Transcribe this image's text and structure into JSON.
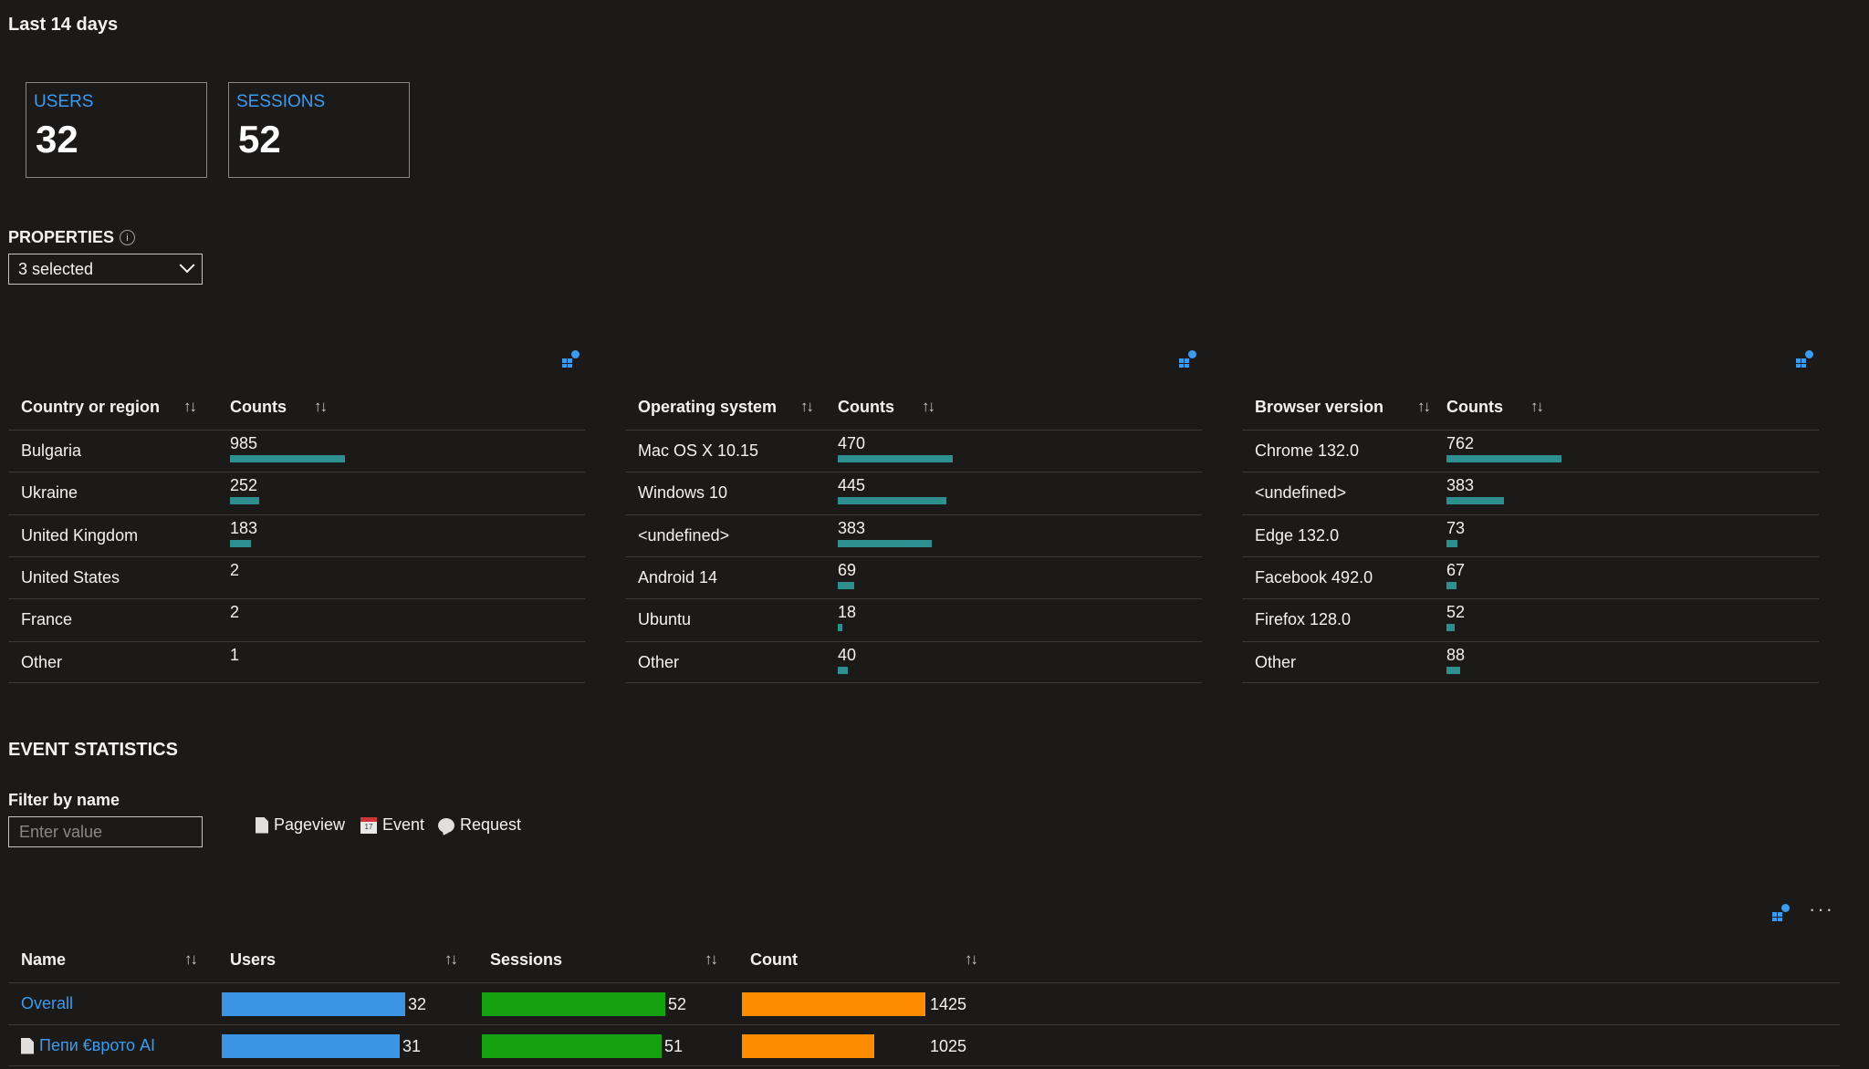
{
  "range_title": "Last 14 days",
  "tiles": [
    {
      "label": "USERS",
      "value": "32"
    },
    {
      "label": "SESSIONS",
      "value": "52"
    }
  ],
  "properties": {
    "label": "PROPERTIES",
    "info_icon": "info-icon",
    "selected": "3 selected"
  },
  "colors": {
    "accent_blue": "#3a9bf0",
    "teal_bar": "#2e8f91",
    "users_bar": "#3a96e4",
    "sessions_bar": "#13a10e",
    "count_bar": "#ff8c00"
  },
  "grids": [
    {
      "name_header": "Country or region",
      "count_header": "Counts",
      "sort_glyph": "↑↓",
      "max": 985,
      "rows": [
        {
          "name": "Bulgaria",
          "count": 985
        },
        {
          "name": "Ukraine",
          "count": 252
        },
        {
          "name": "United Kingdom",
          "count": 183
        },
        {
          "name": "United States",
          "count": 2
        },
        {
          "name": "France",
          "count": 2
        },
        {
          "name": "Other",
          "count": 1
        }
      ]
    },
    {
      "name_header": "Operating system",
      "count_header": "Counts",
      "sort_glyph": "↑↓",
      "max": 470,
      "rows": [
        {
          "name": "Mac OS X 10.15",
          "count": 470
        },
        {
          "name": "Windows 10",
          "count": 445
        },
        {
          "name": "<undefined>",
          "count": 383
        },
        {
          "name": "Android 14",
          "count": 69
        },
        {
          "name": "Ubuntu",
          "count": 18
        },
        {
          "name": "Other",
          "count": 40
        }
      ]
    },
    {
      "name_header": "Browser version",
      "count_header": "Counts",
      "sort_glyph": "↑↓",
      "max": 762,
      "rows": [
        {
          "name": "Chrome 132.0",
          "count": 762
        },
        {
          "name": "<undefined>",
          "count": 383
        },
        {
          "name": "Edge 132.0",
          "count": 73
        },
        {
          "name": "Facebook 492.0",
          "count": 67
        },
        {
          "name": "Firefox 128.0",
          "count": 52
        },
        {
          "name": "Other",
          "count": 88
        }
      ]
    }
  ],
  "event_statistics": {
    "title": "EVENT STATISTICS",
    "filter_label": "Filter by name",
    "filter_placeholder": "Enter value",
    "legend": [
      {
        "icon": "pageview-icon",
        "label": "Pageview"
      },
      {
        "icon": "event-icon",
        "label": "Event"
      },
      {
        "icon": "request-icon",
        "label": "Request"
      }
    ],
    "more": "···",
    "columns": [
      "Name",
      "Users",
      "Sessions",
      "Count"
    ],
    "sort_glyph": "↑↓",
    "max": {
      "users": 32,
      "sessions": 52,
      "count": 1425
    },
    "rows": [
      {
        "name": "Overall",
        "icon": "",
        "users": 32,
        "sessions": 52,
        "count": 1425
      },
      {
        "name": "Пепи €врото AI",
        "icon": "pageview-icon",
        "users": 31,
        "sessions": 51,
        "count": 1025
      }
    ]
  }
}
